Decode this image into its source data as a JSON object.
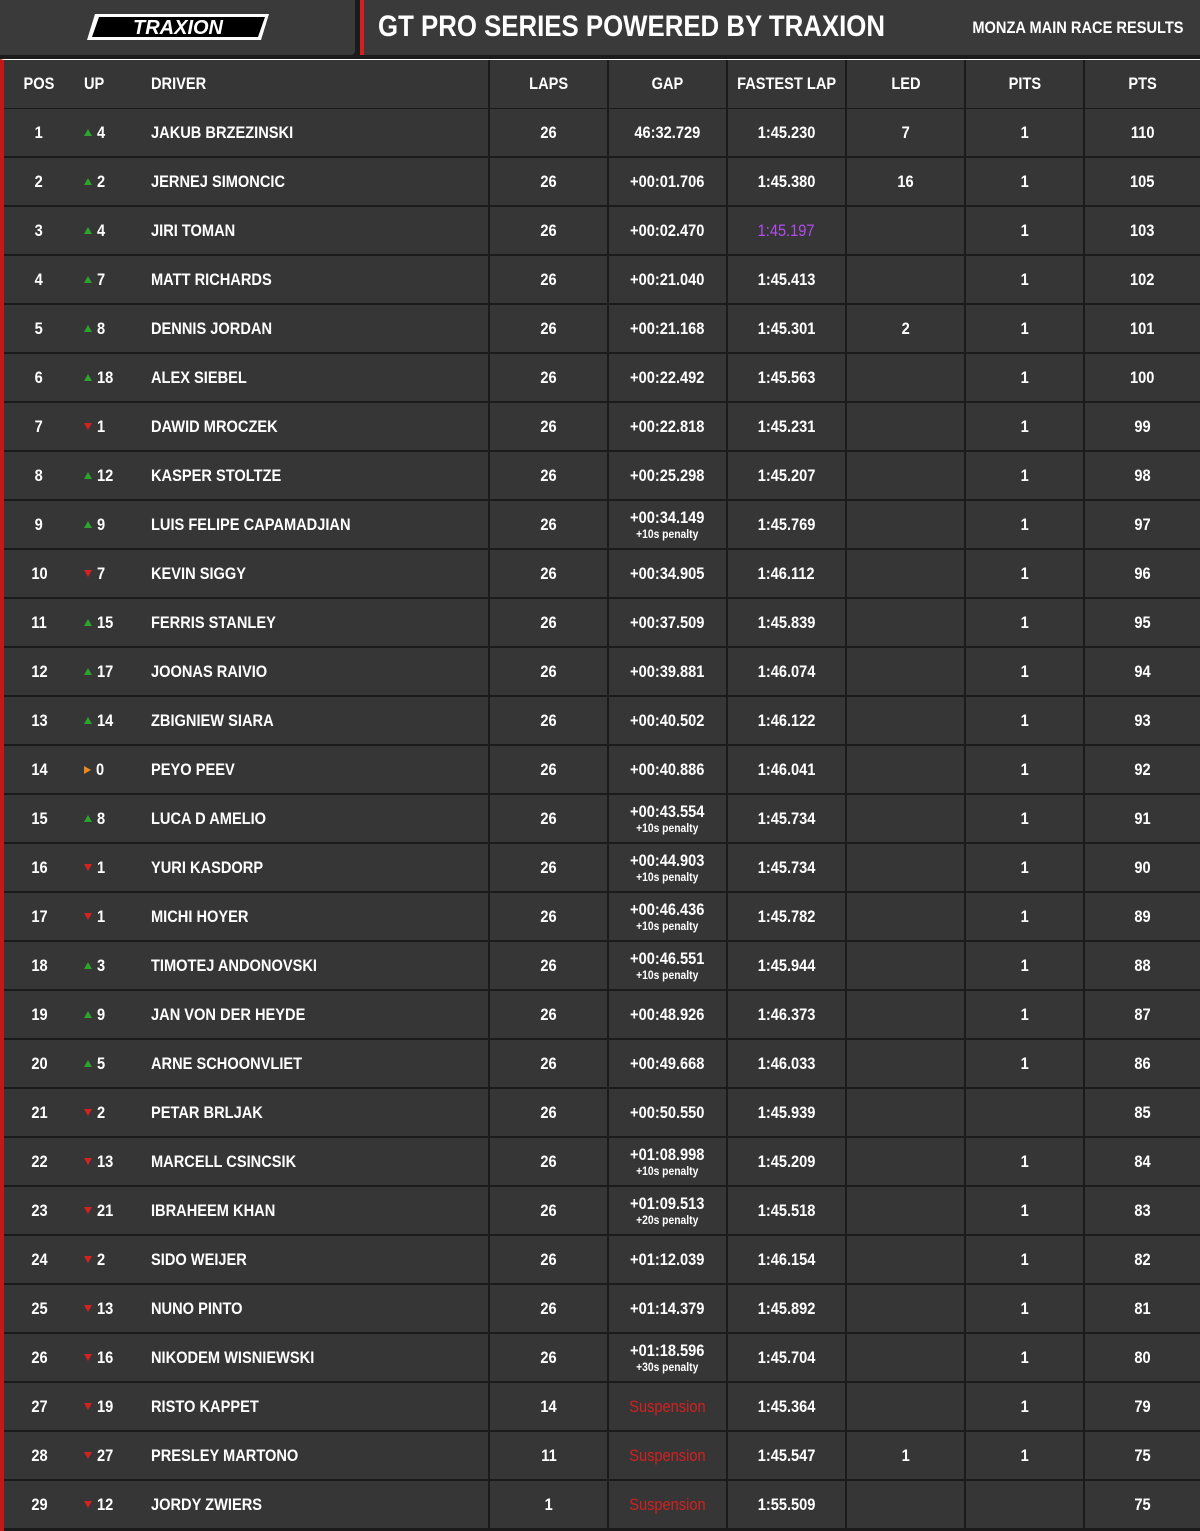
{
  "header": {
    "logo_text": "TRAXION",
    "title": "GT PRO SERIES POWERED BY TRAXION",
    "subtitle": "MONZA MAIN RACE RESULTS"
  },
  "columns": {
    "pos": "POS",
    "up": "UP",
    "driver": "DRIVER",
    "laps": "LAPS",
    "gap": "GAP",
    "fastest_lap": "FASTEST LAP",
    "led": "LED",
    "pits": "PITS",
    "pts": "PTS"
  },
  "colors": {
    "accent_red": "#d21f1f",
    "up_green": "#2aa52a",
    "down_red": "#d42222",
    "same_orange": "#f08a1c",
    "purple_fastest": "#b44cf0",
    "cell_bg": "#363636"
  },
  "rows": [
    {
      "pos": "1",
      "dir": "up",
      "change": "4",
      "driver": "JAKUB BRZEZINSKI",
      "laps": "26",
      "gap": "46:32.729",
      "penalty": "",
      "fastest": "1:45.230",
      "led": "7",
      "pits": "1",
      "pts": "110"
    },
    {
      "pos": "2",
      "dir": "up",
      "change": "2",
      "driver": "JERNEJ SIMONCIC",
      "laps": "26",
      "gap": "+00:01.706",
      "penalty": "",
      "fastest": "1:45.380",
      "led": "16",
      "pits": "1",
      "pts": "105"
    },
    {
      "pos": "3",
      "dir": "up",
      "change": "4",
      "driver": "JIRI TOMAN",
      "laps": "26",
      "gap": "+00:02.470",
      "penalty": "",
      "fastest": "1:45.197",
      "fastest_best": true,
      "led": "",
      "pits": "1",
      "pts": "103"
    },
    {
      "pos": "4",
      "dir": "up",
      "change": "7",
      "driver": "MATT RICHARDS",
      "laps": "26",
      "gap": "+00:21.040",
      "penalty": "",
      "fastest": "1:45.413",
      "led": "",
      "pits": "1",
      "pts": "102"
    },
    {
      "pos": "5",
      "dir": "up",
      "change": "8",
      "driver": "DENNIS JORDAN",
      "laps": "26",
      "gap": "+00:21.168",
      "penalty": "",
      "fastest": "1:45.301",
      "led": "2",
      "pits": "1",
      "pts": "101"
    },
    {
      "pos": "6",
      "dir": "up",
      "change": "18",
      "driver": "ALEX SIEBEL",
      "laps": "26",
      "gap": "+00:22.492",
      "penalty": "",
      "fastest": "1:45.563",
      "led": "",
      "pits": "1",
      "pts": "100"
    },
    {
      "pos": "7",
      "dir": "down",
      "change": "1",
      "driver": "DAWID MROCZEK",
      "laps": "26",
      "gap": "+00:22.818",
      "penalty": "",
      "fastest": "1:45.231",
      "led": "",
      "pits": "1",
      "pts": "99"
    },
    {
      "pos": "8",
      "dir": "up",
      "change": "12",
      "driver": "KASPER STOLTZE",
      "laps": "26",
      "gap": "+00:25.298",
      "penalty": "",
      "fastest": "1:45.207",
      "led": "",
      "pits": "1",
      "pts": "98"
    },
    {
      "pos": "9",
      "dir": "up",
      "change": "9",
      "driver": "LUIS FELIPE CAPAMADJIAN",
      "laps": "26",
      "gap": "+00:34.149",
      "penalty": "+10s penalty",
      "fastest": "1:45.769",
      "led": "",
      "pits": "1",
      "pts": "97"
    },
    {
      "pos": "10",
      "dir": "down",
      "change": "7",
      "driver": "KEVIN SIGGY",
      "laps": "26",
      "gap": "+00:34.905",
      "penalty": "",
      "fastest": "1:46.112",
      "led": "",
      "pits": "1",
      "pts": "96"
    },
    {
      "pos": "11",
      "dir": "up",
      "change": "15",
      "driver": "FERRIS STANLEY",
      "laps": "26",
      "gap": "+00:37.509",
      "penalty": "",
      "fastest": "1:45.839",
      "led": "",
      "pits": "1",
      "pts": "95"
    },
    {
      "pos": "12",
      "dir": "up",
      "change": "17",
      "driver": "JOONAS RAIVIO",
      "laps": "26",
      "gap": "+00:39.881",
      "penalty": "",
      "fastest": "1:46.074",
      "led": "",
      "pits": "1",
      "pts": "94"
    },
    {
      "pos": "13",
      "dir": "up",
      "change": "14",
      "driver": "ZBIGNIEW SIARA",
      "laps": "26",
      "gap": "+00:40.502",
      "penalty": "",
      "fastest": "1:46.122",
      "led": "",
      "pits": "1",
      "pts": "93"
    },
    {
      "pos": "14",
      "dir": "same",
      "change": "0",
      "driver": "PEYO PEEV",
      "laps": "26",
      "gap": "+00:40.886",
      "penalty": "",
      "fastest": "1:46.041",
      "led": "",
      "pits": "1",
      "pts": "92"
    },
    {
      "pos": "15",
      "dir": "up",
      "change": "8",
      "driver": "LUCA D AMELIO",
      "laps": "26",
      "gap": "+00:43.554",
      "penalty": "+10s penalty",
      "fastest": "1:45.734",
      "led": "",
      "pits": "1",
      "pts": "91"
    },
    {
      "pos": "16",
      "dir": "down",
      "change": "1",
      "driver": "YURI KASDORP",
      "laps": "26",
      "gap": "+00:44.903",
      "penalty": "+10s penalty",
      "fastest": "1:45.734",
      "led": "",
      "pits": "1",
      "pts": "90"
    },
    {
      "pos": "17",
      "dir": "down",
      "change": "1",
      "driver": "MICHI HOYER",
      "laps": "26",
      "gap": "+00:46.436",
      "penalty": "+10s penalty",
      "fastest": "1:45.782",
      "led": "",
      "pits": "1",
      "pts": "89"
    },
    {
      "pos": "18",
      "dir": "up",
      "change": "3",
      "driver": "TIMOTEJ ANDONOVSKI",
      "laps": "26",
      "gap": "+00:46.551",
      "penalty": "+10s penalty",
      "fastest": "1:45.944",
      "led": "",
      "pits": "1",
      "pts": "88"
    },
    {
      "pos": "19",
      "dir": "up",
      "change": "9",
      "driver": "JAN VON DER HEYDE",
      "laps": "26",
      "gap": "+00:48.926",
      "penalty": "",
      "fastest": "1:46.373",
      "led": "",
      "pits": "1",
      "pts": "87"
    },
    {
      "pos": "20",
      "dir": "up",
      "change": "5",
      "driver": "ARNE SCHOONVLIET",
      "laps": "26",
      "gap": "+00:49.668",
      "penalty": "",
      "fastest": "1:46.033",
      "led": "",
      "pits": "1",
      "pts": "86"
    },
    {
      "pos": "21",
      "dir": "down",
      "change": "2",
      "driver": "PETAR BRLJAK",
      "laps": "26",
      "gap": "+00:50.550",
      "penalty": "",
      "fastest": "1:45.939",
      "led": "",
      "pits": "",
      "pts": "85"
    },
    {
      "pos": "22",
      "dir": "down",
      "change": "13",
      "driver": "MARCELL CSINCSIK",
      "laps": "26",
      "gap": "+01:08.998",
      "penalty": "+10s penalty",
      "fastest": "1:45.209",
      "led": "",
      "pits": "1",
      "pts": "84"
    },
    {
      "pos": "23",
      "dir": "down",
      "change": "21",
      "driver": "IBRAHEEM KHAN",
      "laps": "26",
      "gap": "+01:09.513",
      "penalty": "+20s penalty",
      "fastest": "1:45.518",
      "led": "",
      "pits": "1",
      "pts": "83"
    },
    {
      "pos": "24",
      "dir": "down",
      "change": "2",
      "driver": "SIDO WEIJER",
      "laps": "26",
      "gap": "+01:12.039",
      "penalty": "",
      "fastest": "1:46.154",
      "led": "",
      "pits": "1",
      "pts": "82"
    },
    {
      "pos": "25",
      "dir": "down",
      "change": "13",
      "driver": "NUNO PINTO",
      "laps": "26",
      "gap": "+01:14.379",
      "penalty": "",
      "fastest": "1:45.892",
      "led": "",
      "pits": "1",
      "pts": "81"
    },
    {
      "pos": "26",
      "dir": "down",
      "change": "16",
      "driver": "NIKODEM WISNIEWSKI",
      "laps": "26",
      "gap": "+01:18.596",
      "penalty": "+30s penalty",
      "fastest": "1:45.704",
      "led": "",
      "pits": "1",
      "pts": "80"
    },
    {
      "pos": "27",
      "dir": "down",
      "change": "19",
      "driver": "RISTO KAPPET",
      "laps": "14",
      "gap": "Suspension",
      "suspended": true,
      "penalty": "",
      "fastest": "1:45.364",
      "led": "",
      "pits": "1",
      "pts": "79"
    },
    {
      "pos": "28",
      "dir": "down",
      "change": "27",
      "driver": "PRESLEY MARTONO",
      "laps": "11",
      "gap": "Suspension",
      "suspended": true,
      "penalty": "",
      "fastest": "1:45.547",
      "led": "1",
      "pits": "1",
      "pts": "75"
    },
    {
      "pos": "29",
      "dir": "down",
      "change": "12",
      "driver": "JORDY ZWIERS",
      "laps": "1",
      "gap": "Suspension",
      "suspended": true,
      "penalty": "",
      "fastest": "1:55.509",
      "led": "",
      "pits": "",
      "pts": "75"
    }
  ]
}
